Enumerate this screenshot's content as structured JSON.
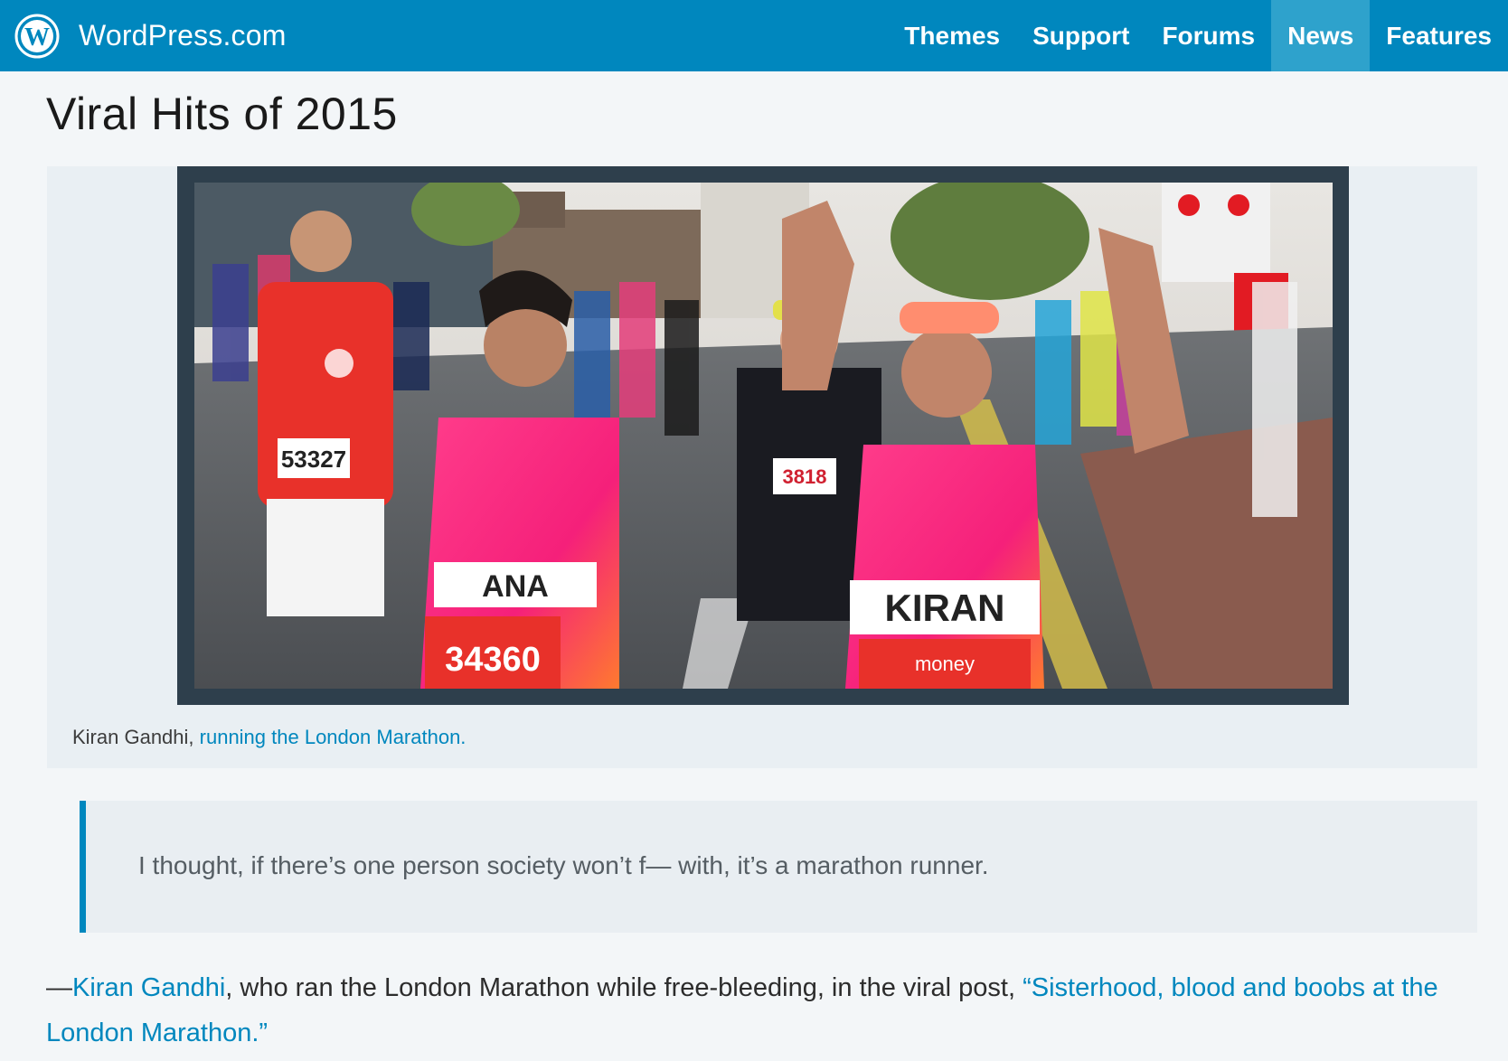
{
  "masterbar": {
    "brand": "WordPress.com",
    "nav": [
      "Themes",
      "Support",
      "Forums",
      "News",
      "Features"
    ],
    "active_nav": "News",
    "color": "#0087be",
    "active_color": "#2ea2cc"
  },
  "page": {
    "title": "Viral Hits of 2015"
  },
  "figure": {
    "photo_alt": "Runners at the London Marathon",
    "bibs": [
      "53327",
      "ANA",
      "34360",
      "KIRAN",
      "3818"
    ],
    "sponsor": "money",
    "caption_prefix": "Kiran Gandhi, ",
    "caption_link": "running the London Marathon."
  },
  "quote": {
    "text": "I thought, if there’s one person society won’t f— with, it’s a marathon runner."
  },
  "attribution": {
    "dash": "—",
    "author_link": "Kiran Gandhi",
    "middle": ", who ran the London Marathon while free-bleeding, in the viral post, ",
    "post_link": "“Sisterhood, blood and boobs at the London Marathon.”"
  }
}
